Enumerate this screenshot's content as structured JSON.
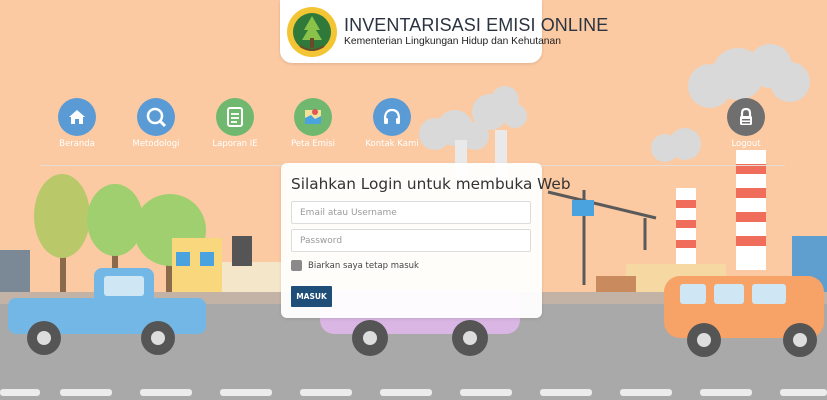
{
  "header": {
    "title": "INVENTARISASI EMISI ONLINE",
    "subtitle": "Kementerian Lingkungan Hidup dan Kehutanan"
  },
  "nav": {
    "items": [
      {
        "label": "Beranda",
        "icon": "home-icon",
        "color": "#5b9bd5"
      },
      {
        "label": "Metodologi",
        "icon": "search-doc-icon",
        "color": "#5b9bd5"
      },
      {
        "label": "Laporan IE",
        "icon": "report-icon",
        "color": "#70b86f"
      },
      {
        "label": "Peta Emisi",
        "icon": "map-icon",
        "color": "#70b86f"
      },
      {
        "label": "Kontak Kami",
        "icon": "headset-icon",
        "color": "#5b9bd5"
      },
      {
        "label": "Logout",
        "icon": "lock-icon",
        "color": "#6f6f6f"
      }
    ]
  },
  "login": {
    "title": "Silahkan Login untuk membuka Web",
    "email_placeholder": "Email atau Username",
    "password_placeholder": "Password",
    "remember_label": "Biarkan saya tetap masuk",
    "submit_label": "MASUK"
  },
  "colors": {
    "sky": "#fbcaa3",
    "road": "#a9a9a9",
    "button": "#1f4e79"
  }
}
